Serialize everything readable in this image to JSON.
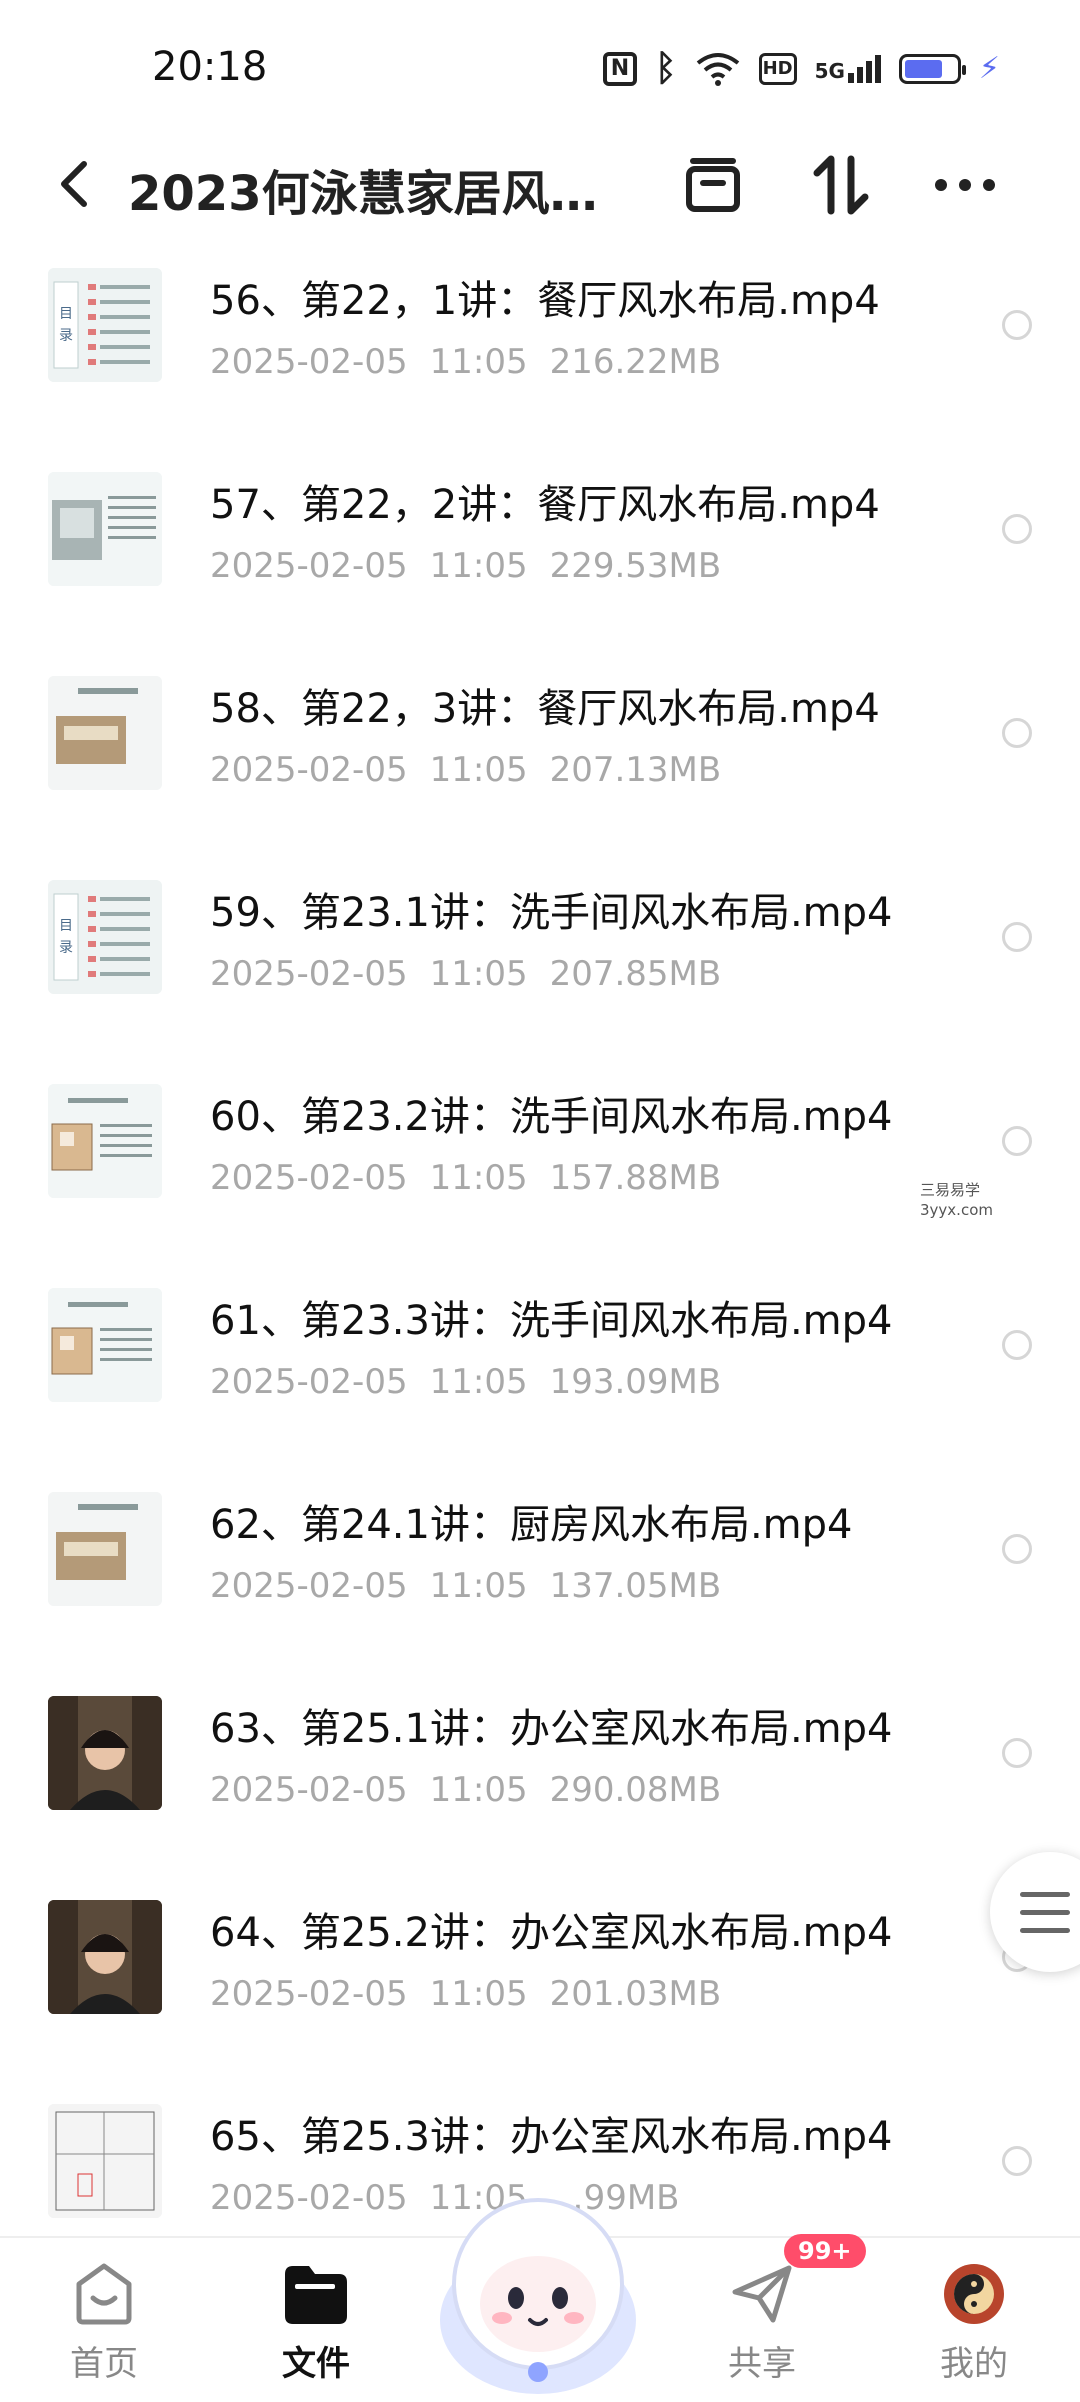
{
  "status_bar": {
    "time": "20:18",
    "icons": [
      "nfc-icon",
      "bluetooth-icon",
      "wifi-icon",
      "hd-icon",
      "signal-5g-icon",
      "battery-icon",
      "charging-icon"
    ],
    "network": "5G",
    "hd": "HD",
    "battery_level": 0.75
  },
  "header": {
    "title": "2023何泳慧家居风…",
    "icons": [
      "back-icon",
      "select-box-icon",
      "sort-icon",
      "more-icon"
    ]
  },
  "files": [
    {
      "name": "56、第22，1讲：餐厅风水布局.mp4",
      "date": "2025-02-05",
      "time": "11:05",
      "size": "216.22MB",
      "thumb": "catalog",
      "thumb_text": "目录"
    },
    {
      "name": "57、第22，2讲：餐厅风水布局.mp4",
      "date": "2025-02-05",
      "time": "11:05",
      "size": "229.53MB",
      "thumb": "slide-room"
    },
    {
      "name": "58、第22，3讲：餐厅风水布局.mp4",
      "date": "2025-02-05",
      "time": "11:05",
      "size": "207.13MB",
      "thumb": "slide-kitchen"
    },
    {
      "name": "59、第23.1讲：洗手间风水布局.mp4",
      "date": "2025-02-05",
      "time": "11:05",
      "size": "207.85MB",
      "thumb": "catalog",
      "thumb_text": "目录"
    },
    {
      "name": "60、第23.2讲：洗手间风水布局.mp4",
      "date": "2025-02-05",
      "time": "11:05",
      "size": "157.88MB",
      "thumb": "slide-plan"
    },
    {
      "name": "61、第23.3讲：洗手间风水布局.mp4",
      "date": "2025-02-05",
      "time": "11:05",
      "size": "193.09MB",
      "thumb": "slide-plan"
    },
    {
      "name": "62、第24.1讲：厨房风水布局.mp4",
      "date": "2025-02-05",
      "time": "11:05",
      "size": "137.05MB",
      "thumb": "slide-kitchen"
    },
    {
      "name": "63、第25.1讲：办公室风水布局.mp4",
      "date": "2025-02-05",
      "time": "11:05",
      "size": "290.08MB",
      "thumb": "person"
    },
    {
      "name": "64、第25.2讲：办公室风水布局.mp4",
      "date": "2025-02-05",
      "time": "11:05",
      "size": "201.03MB",
      "thumb": "person"
    },
    {
      "name": "65、第25.3讲：办公室风水布局.mp4",
      "date": "2025-02-05",
      "time": "11:05",
      "size": "…99MB",
      "thumb": "floorplan"
    }
  ],
  "watermark": {
    "line1": "三易易学",
    "line2": "3yyx.com"
  },
  "bottom_nav": [
    {
      "label": "首页",
      "icon": "home-icon",
      "active": false
    },
    {
      "label": "文件",
      "icon": "folder-icon",
      "active": true
    },
    {
      "label": "共享",
      "icon": "send-icon",
      "active": false
    },
    {
      "label": "我的",
      "icon": "avatar-icon",
      "active": false
    }
  ],
  "badge": "99+",
  "colors": {
    "accent": "#5b6cf0",
    "badge": "#ff4d6a",
    "meta": "#a8a8a8"
  }
}
